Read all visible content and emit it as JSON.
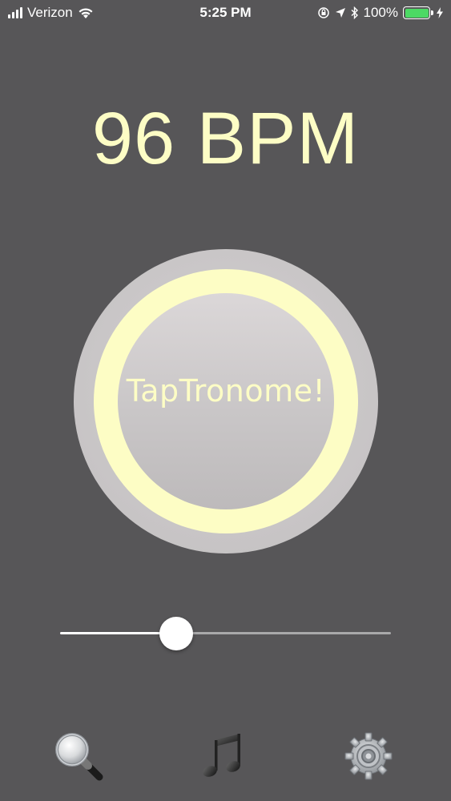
{
  "status_bar": {
    "carrier": "Verizon",
    "time": "5:25 PM",
    "battery_percent": "100%",
    "icons": [
      "signal-icon",
      "wifi-icon",
      "orientation-lock-icon",
      "location-icon",
      "bluetooth-icon",
      "battery-icon",
      "charging-icon"
    ]
  },
  "tempo": {
    "bpm_text": "96 BPM"
  },
  "tap_button": {
    "label": "TapTronome!"
  },
  "tempo_slider": {
    "value_fraction": 0.335
  },
  "toolbar": {
    "items": [
      "search-icon",
      "music-note-icon",
      "settings-gear-icon"
    ]
  },
  "colors": {
    "background": "#575658",
    "accent": "#fdfdc5",
    "button_gray": "#c9c6c7",
    "battery_green": "#4cd964"
  }
}
